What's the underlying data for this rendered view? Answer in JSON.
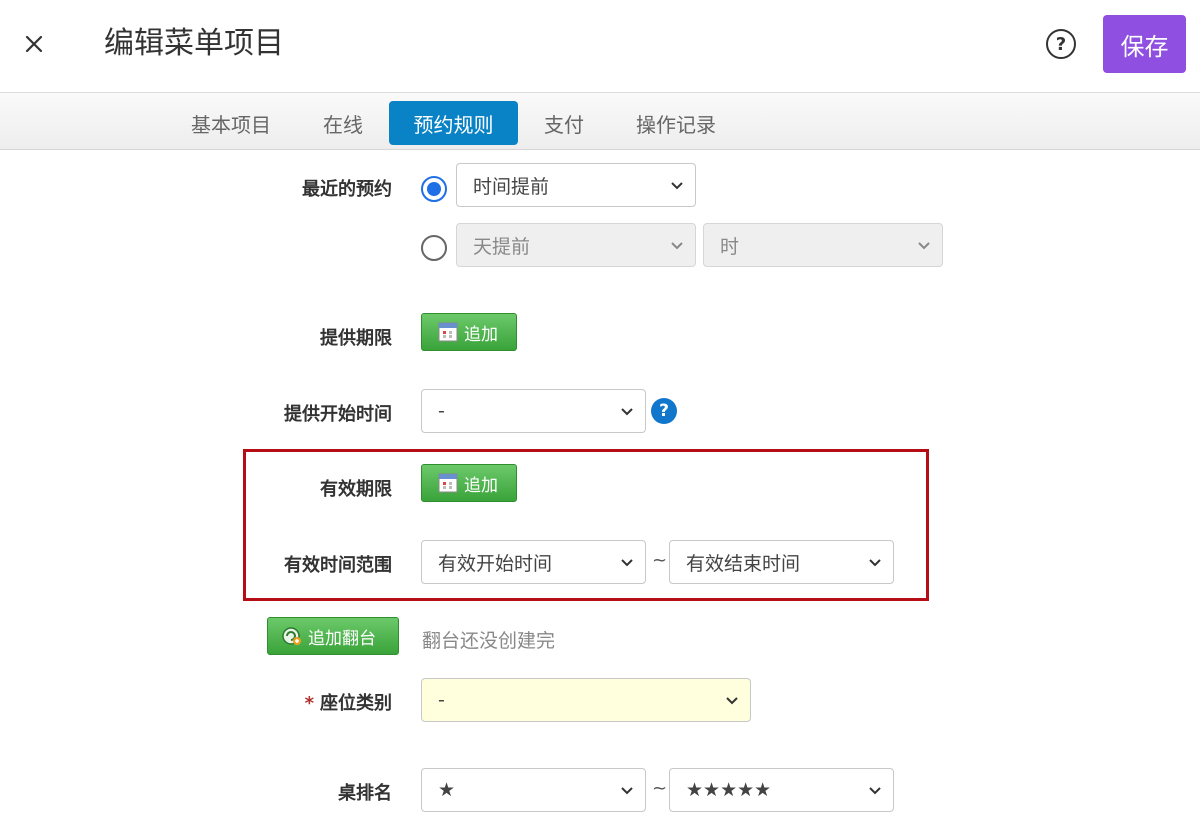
{
  "header": {
    "title": "编辑菜单项目",
    "help_label": "?",
    "save_label": "保存"
  },
  "tabs": [
    {
      "label": "基本项目"
    },
    {
      "label": "在线"
    },
    {
      "label": "预约规则"
    },
    {
      "label": "支付"
    },
    {
      "label": "操作记录"
    }
  ],
  "form": {
    "recent_booking": {
      "label": "最近的预约",
      "option1_value": "时间提前",
      "option2_days_value": "天提前",
      "option2_hours_value": "时"
    },
    "offer_period": {
      "label": "提供期限",
      "button": "追加"
    },
    "offer_start": {
      "label": "提供开始时间",
      "value": "-"
    },
    "valid_period": {
      "label": "有效期限",
      "button": "追加"
    },
    "valid_range": {
      "label": "有效时间范围",
      "start_value": "有效开始时间",
      "separator": "~",
      "end_value": "有效结束时间"
    },
    "turnover": {
      "button": "追加翻台",
      "note": "翻台还没创建完"
    },
    "seat_type": {
      "required_mark": "*",
      "label": "座位类别",
      "value": "-"
    },
    "table_rank": {
      "label": "桌排名",
      "min_value": "★",
      "separator": "~",
      "max_value": "★★★★★"
    }
  },
  "colors": {
    "accent_purple": "#8f4fe0",
    "tab_active": "#0a83c6",
    "highlight_red": "#b50d15",
    "green_button": "#3aa33a"
  }
}
